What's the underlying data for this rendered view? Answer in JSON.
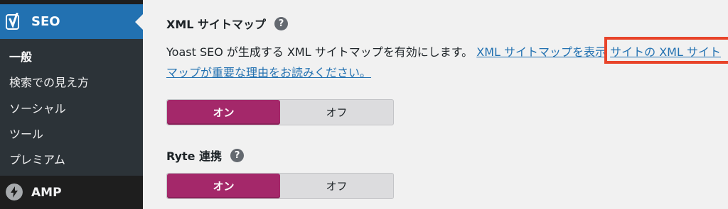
{
  "sidebar": {
    "seo_label": "SEO",
    "items": [
      {
        "label": "一般"
      },
      {
        "label": "検索での見え方"
      },
      {
        "label": "ソーシャル"
      },
      {
        "label": "ツール"
      },
      {
        "label": "プレミアム"
      }
    ],
    "amp_label": "AMP"
  },
  "main": {
    "xml_section": {
      "title": "XML サイトマップ",
      "help": "?",
      "description_prefix": "Yoast SEO が生成する XML サイトマップを有効にします。",
      "link_view": "XML サイトマップを表示",
      "link_reason": "サイトの XML サイトマップが重要な理由をお読みください。",
      "toggle_on": "オン",
      "toggle_off": "オフ",
      "state": "on"
    },
    "ryte_section": {
      "title": "Ryte 連携",
      "help": "?",
      "toggle_on": "オン",
      "toggle_off": "オフ",
      "state": "on"
    }
  },
  "colors": {
    "highlight_border": "#e8442a",
    "toggle_active": "#a4286a",
    "menu_active": "#2271b1",
    "link": "#2271b1"
  }
}
